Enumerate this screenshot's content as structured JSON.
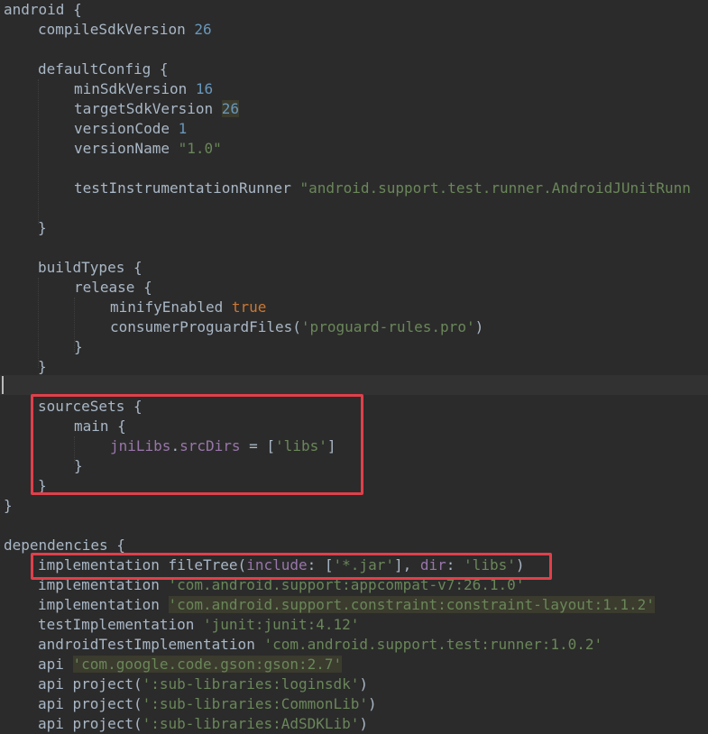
{
  "colors": {
    "background": "#2b2b2b",
    "text": "#a9b7c6",
    "keyword": "#cc7832",
    "number": "#6897bb",
    "string": "#6a8759",
    "property": "#9876aa",
    "annotation_box": "#e0404a"
  },
  "code": {
    "l1": "android {",
    "l2_a": "compileSdkVersion ",
    "l2_b": "26",
    "l4": "defaultConfig {",
    "l5_a": "minSdkVersion ",
    "l5_b": "16",
    "l6_a": "targetSdkVersion ",
    "l6_b": "26",
    "l7_a": "versionCode ",
    "l7_b": "1",
    "l8_a": "versionName ",
    "l8_b": "\"1.0\"",
    "l10_a": "testInstrumentationRunner ",
    "l10_b": "\"android.support.test.runner.AndroidJUnitRunn",
    "l12": "}",
    "l14": "buildTypes {",
    "l15": "release {",
    "l16_a": "minifyEnabled ",
    "l16_b": "true",
    "l17_a": "consumerProguardFiles(",
    "l17_b": "'proguard-rules.pro'",
    "l17_c": ")",
    "l18": "}",
    "l19": "}",
    "l21": "sourceSets {",
    "l22": "main {",
    "l23_a": "jniLibs",
    "l23_b": ".",
    "l23_c": "srcDirs",
    "l23_d": " = [",
    "l23_e": "'libs'",
    "l23_f": "]",
    "l24": "}",
    "l25": "}",
    "l26": "}",
    "l28": "dependencies {",
    "l29_a": "implementation fileTree(",
    "l29_b": "include",
    "l29_c": ": [",
    "l29_d": "'*.jar'",
    "l29_e": "], ",
    "l29_f": "dir",
    "l29_g": ": ",
    "l29_h": "'libs'",
    "l29_i": ")",
    "l30_a": "implementation ",
    "l30_b": "'com.android.support:appcompat-v7:26.1.0'",
    "l31_a": "implementation ",
    "l31_b": "'com.android.support.constraint:constraint-layout:1.1.2'",
    "l32_a": "testImplementation ",
    "l32_b": "'junit:junit:4.12'",
    "l33_a": "androidTestImplementation ",
    "l33_b": "'com.android.support.test:runner:1.0.2'",
    "l34_a": "api ",
    "l34_b": "'com.google.code.gson:gson:2.7'",
    "l35_a": "api project(",
    "l35_b": "':sub-libraries:loginsdk'",
    "l35_c": ")",
    "l36_a": "api project(",
    "l36_b": "':sub-libraries:CommonLib'",
    "l36_c": ")",
    "l37_a": "api project(",
    "l37_b": "':sub-libraries:AdSDKLib'",
    "l37_c": ")"
  }
}
